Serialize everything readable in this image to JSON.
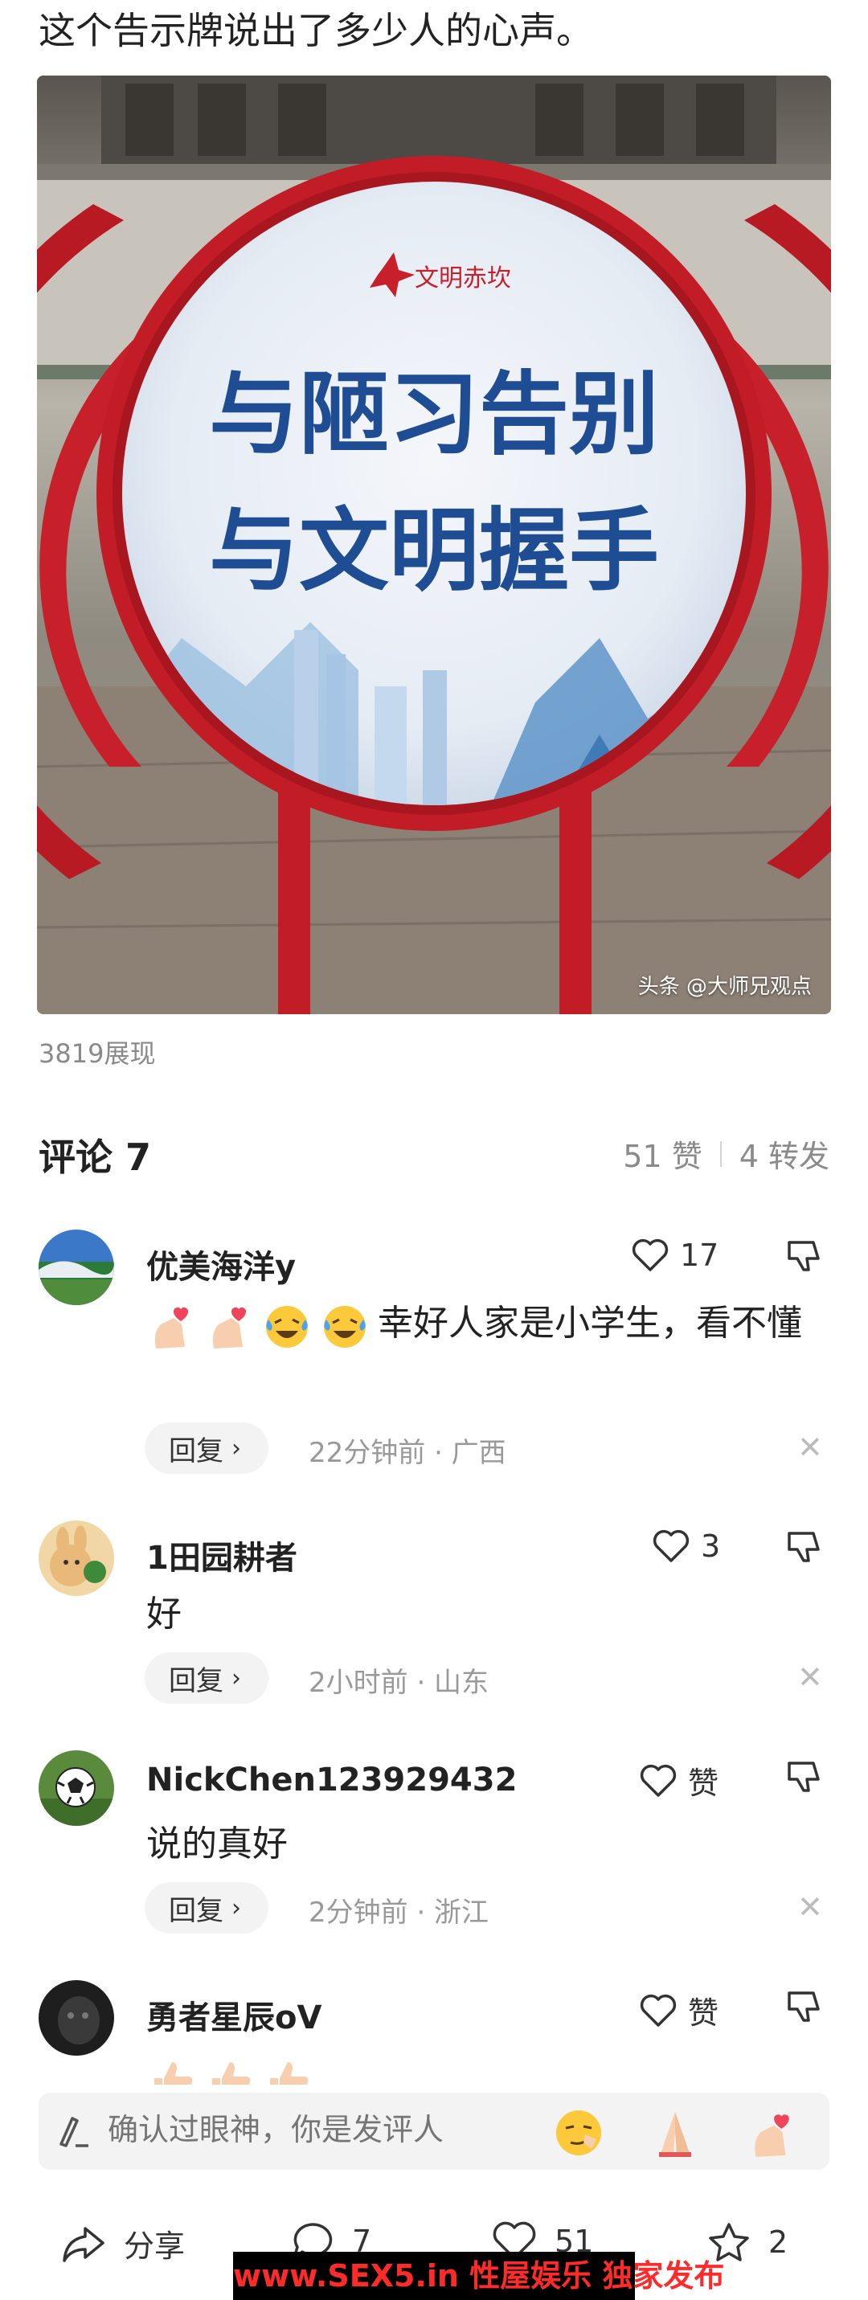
{
  "post": {
    "text": "这个告示牌说出了多少人的心声。",
    "image": {
      "sign_logo": "文明赤坎",
      "sign_line1": "与陋习告别",
      "sign_line2": "与文明握手",
      "watermark": "头条 @大师兄观点"
    },
    "views": "3819展现"
  },
  "comments_header": {
    "title": "评论 7",
    "likes": "51 赞",
    "shares": "4 转发"
  },
  "comments": [
    {
      "name": "优美海洋y",
      "like_count": "17",
      "body_text": "幸好人家是小学生，看不懂",
      "emojis": [
        "heart-hand-emoji",
        "heart-hand-emoji",
        "laughing-crying-emoji",
        "laughing-crying-emoji"
      ],
      "reply_label": "回复",
      "meta": "22分钟前 · 广西"
    },
    {
      "name": "1田园耕者",
      "like_count": "3",
      "body_text": "好",
      "reply_label": "回复",
      "meta": "2小时前 · 山东"
    },
    {
      "name": "NickChen123929432",
      "like_count": "赞",
      "body_text": "说的真好",
      "reply_label": "回复",
      "meta": "2分钟前 · 浙江"
    },
    {
      "name": "勇者星辰oV",
      "like_count": "赞",
      "emojis": [
        "thumbs-up-emoji",
        "thumbs-up-emoji",
        "thumbs-up-emoji"
      ]
    }
  ],
  "input": {
    "placeholder": "确认过眼神，你是发评人",
    "quick_emojis": [
      "smirk-emoji",
      "praying-hands-emoji",
      "heart-hand-emoji"
    ]
  },
  "bottom_bar": {
    "share_label": "分享",
    "comment_count": "7",
    "like_count": "51",
    "favorite_count": "2"
  },
  "ad_banner": "www.SEX5.in 性屋娱乐 独家发布",
  "colors": {
    "accent_red": "#d11f2a",
    "text_primary": "#222222",
    "text_secondary": "#999999"
  }
}
